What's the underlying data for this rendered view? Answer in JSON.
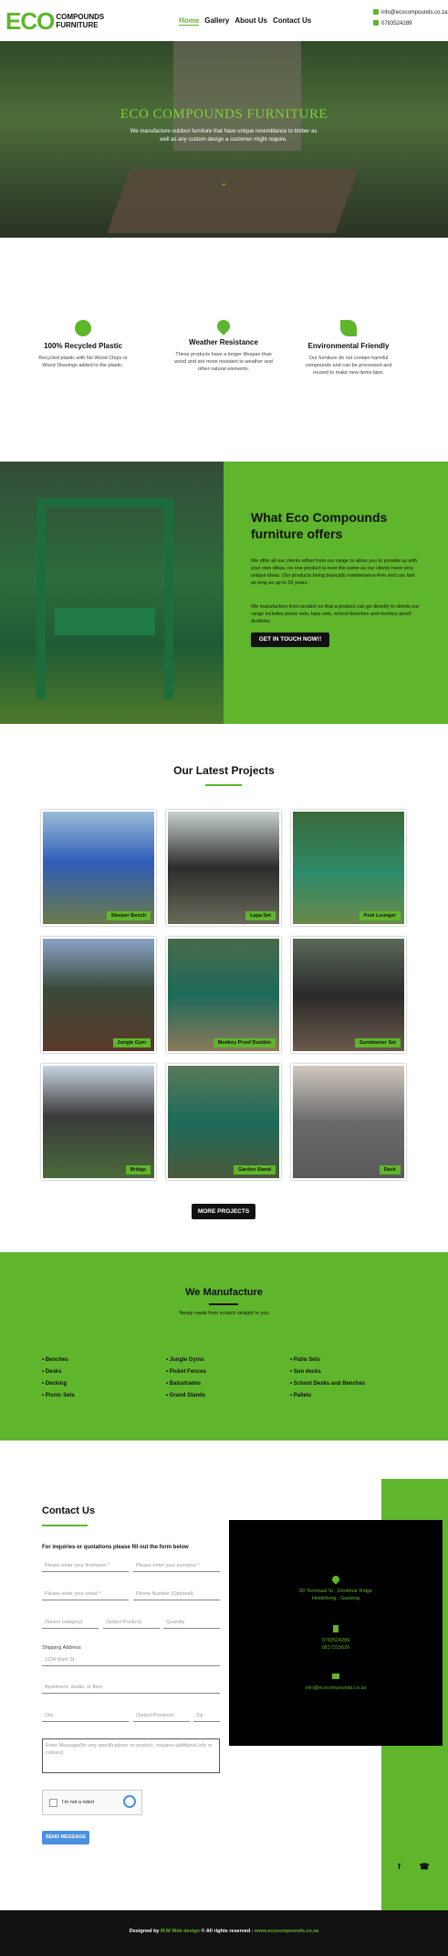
{
  "header": {
    "logo_eco": "ECO",
    "logo_line1": "COMPOUNDS",
    "logo_line2": "FURNITURE",
    "nav": [
      "Home",
      "Gallery",
      "About Us",
      "Contact Us"
    ],
    "email": "info@ecocompounds.co.za",
    "phone": "0783524289"
  },
  "hero": {
    "title": "ECO COMPOUNDS FURNITURE",
    "text": "We manufacture outdoor furniture that have unique resemblance to timber as well as any custom design a customer might require."
  },
  "features": [
    {
      "icon": "recycle-icon",
      "title": "100% Recycled Plastic",
      "text": "Recycled plastic with No Wood Chips or Wood Shavings added to the plastic."
    },
    {
      "icon": "water-drop-icon",
      "title": "Weather Resistance",
      "text": "These products have a longer lifespan than wood and are more resistant to weather and other natural elements."
    },
    {
      "icon": "leaf-icon",
      "title": "Environmental Friendly",
      "text": "Our furniture do not contain harmful compounds and can be processed and reused to make new items later."
    }
  ],
  "offers": {
    "title": "What Eco Compounds furniture offers",
    "p1": "We offer all our clients either from our range or allow you to provide us with your own ideas, no one product is ever the same as our clients have very unique ideas. Our products being basically maintenance-free and can last as long as up to 25 years.",
    "p2": "We manufacture from scratch so that a product can go directly to clients our range includes picnic sets, lapa sets, school benches and monkey-proof dustbins.",
    "button": "GET IN TOUCH NOW!!"
  },
  "projects": {
    "title": "Our Latest Projects",
    "items": [
      "Sleeper Bench",
      "Lapa Set",
      "Pool Lounger",
      "Jungle Gym",
      "Monkey Proof Dustbin",
      "Sundowner Set",
      "Bridge",
      "Garden Stand",
      "Deck"
    ],
    "button": "MORE PROJECTS"
  },
  "manufacture": {
    "title": "We Manufacture",
    "subtitle": "Newly made from scratch straight to you",
    "col1": [
      "Benches",
      "Desks",
      "Decking",
      "Picnic Sets"
    ],
    "col2": [
      "Jungle Gyms",
      "Picket Fences",
      "Balustrades",
      "Grand Stands"
    ],
    "col3": [
      "Patio Sets",
      "Sun decks",
      "School Desks and Benches",
      "Pallets"
    ]
  },
  "contact": {
    "title": "Contact Us",
    "intro": "For inquiries or quotations please fill out the form below",
    "firstname": "Please enter your firstname *",
    "surname": "Please enter your surname *",
    "email": "Please enter your email *",
    "phone": "Phone Number (Optional)",
    "category": "(Select category)",
    "product": "(Select Product)",
    "quantity": "Quantity",
    "shipping_label": "Shipping Address",
    "street": "1234 Main St",
    "apartment": "Apartment, studio, or floor",
    "city": "City",
    "province": "(Select Province)",
    "zip": "Zip",
    "message": "Enter Message(for any specifications on product, requires additional info or colours)",
    "captcha": "I'm not a robot",
    "send": "SEND MESSAGE",
    "address_line1": "99 Torontaal St , Gholtmar Ridge",
    "address_line2": "Heidelberg , Gauteng",
    "phone1": "0783524289",
    "phone2": "0817215626",
    "email_info": "info@ecocompounds.co.za"
  },
  "footer": {
    "prefix": "Designed by",
    "designer": "M.M Web design",
    "rights": "© All rights reserved -",
    "site": "www.ecocompounds.co.za"
  },
  "colors": {
    "accent": "#5fb52b",
    "dark": "#111111"
  }
}
